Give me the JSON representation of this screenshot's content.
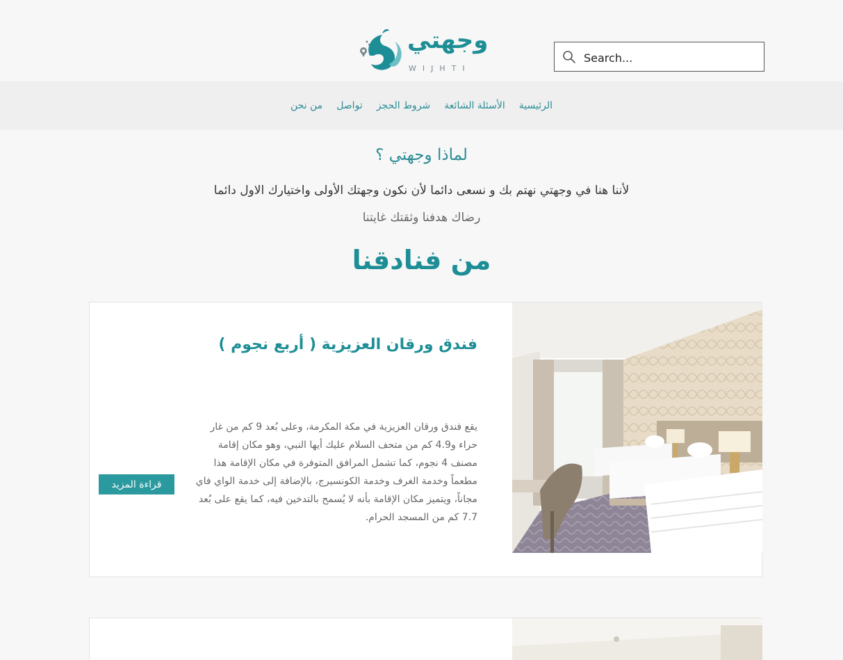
{
  "header": {
    "logo": {
      "word": "وجهتي",
      "sub": "WIJHTI"
    },
    "search": {
      "placeholder": "Search..."
    }
  },
  "nav": {
    "items": [
      {
        "label": "الرئيسية"
      },
      {
        "label": "الأسئلة الشائعة"
      },
      {
        "label": "شروط الحجز"
      },
      {
        "label": "تواصل"
      },
      {
        "label": "من نحن"
      }
    ]
  },
  "intro": {
    "title": "لماذا وجهتي ؟",
    "line1": "لأننا هنا في وجهتي نهتم بك و نسعى دائما لأن نكون وجهتك الأولى واختيارك الاول دائما",
    "line2": "رضاك هدفنا وثقتك غايتنا"
  },
  "hotels": {
    "title": "من فنادقنا",
    "cards": [
      {
        "title": "فندق ورقان العزيزية ( أربع نجوم )",
        "description": "يقع فندق ورقان العزيزية في مكة المكرمة، وعلى بُعد 9 كم من غار حراء و4.9 كم من متحف السلام عليك أيها النبي، وهو مكان إقامة مصنف 4 نجوم، كما تشمل المرافق المتوفرة في مكان الإقامة هذا مطعماً وخدمة الغرف وخدمة الكونسيرج، بالإضافة إلى خدمة الواي فاي مجاناً، ويتميز مكان الإقامة بأنه لا يُسمح بالتدخين فيه، كما يقع على بُعد 7.7 كم من المسجد الحرام.",
        "read_more": "قراءة المزيد"
      }
    ]
  },
  "colors": {
    "brand": "#1e8e96",
    "button": "#2a9a9f"
  }
}
